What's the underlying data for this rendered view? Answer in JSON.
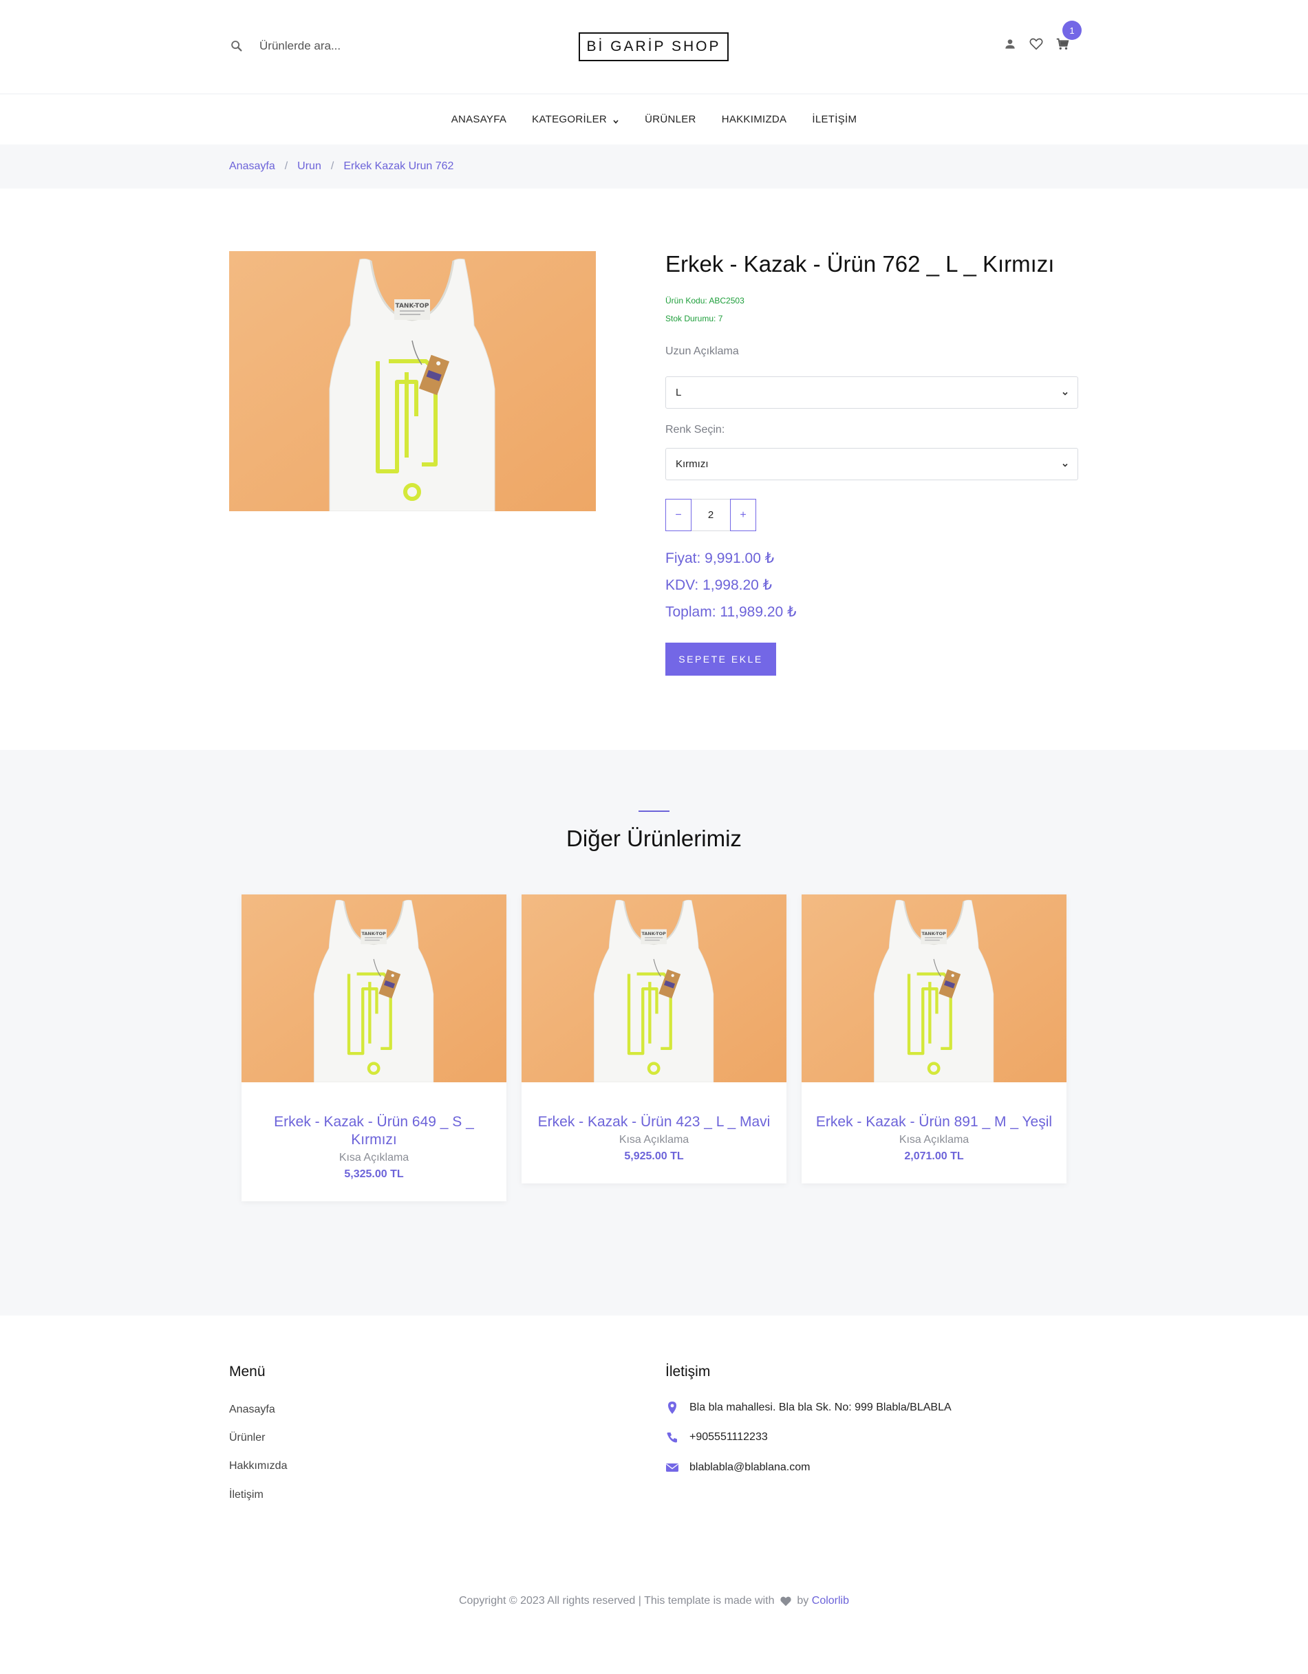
{
  "header": {
    "search_placeholder": "Ürünlerde ara...",
    "logo": "Bİ GARİP SHOP",
    "cart_count": "1",
    "icons": [
      "user-icon",
      "heart-icon",
      "cart-icon"
    ]
  },
  "nav": {
    "items": [
      "ANASAYFA",
      "KATEGORİLER",
      "ÜRÜNLER",
      "HAKKIMIZDA",
      "İLETİŞİM"
    ]
  },
  "breadcrumb": {
    "items": [
      "Anasayfa",
      "Urun",
      "Erkek Kazak Urun 762"
    ],
    "separator": "/"
  },
  "product": {
    "title": "Erkek - Kazak - Ürün 762 _ L _ Kırmızı",
    "code": "Ürün Kodu: ABC2503",
    "stock": "Stok Durumu: 7",
    "size_label": "Uzun Açıklama",
    "size_value": "L",
    "color_label": "Renk Seçin:",
    "color_value": "Kırmızı",
    "qty_minus": "−",
    "qty": "2",
    "qty_plus": "+",
    "price": "Fiyat: 9,991.00 ₺",
    "tax": "KDV: 1,998.20 ₺",
    "total": "Toplam: 11,989.20 ₺",
    "add_to_cart": "SEPETE EKLE"
  },
  "others": {
    "title": "Diğer Ürünlerimiz",
    "cards": [
      {
        "name": "Erkek - Kazak - Ürün 649 _ S _ Kırmızı",
        "desc": "Kısa Açıklama",
        "price": "5,325.00 TL"
      },
      {
        "name": "Erkek - Kazak - Ürün 423 _ L _ Mavi",
        "desc": "Kısa Açıklama",
        "price": "5,925.00 TL"
      },
      {
        "name": "Erkek - Kazak - Ürün 891 _ M _ Yeşil",
        "desc": "Kısa Açıklama",
        "price": "2,071.00 TL"
      }
    ]
  },
  "footer": {
    "menu_title": "Menü",
    "menu": [
      "Anasayfa",
      "Ürünler",
      "Hakkımızda",
      "İletişim"
    ],
    "contact_title": "İletişim",
    "address": "Bla bla mahallesi. Bla bla Sk. No: 999 Blabla/BLABLA",
    "phone": "+905551112233",
    "email": "blablabla@blablana.com",
    "copyright_pre": "Copyright © 2023 All rights reserved | This template is made with",
    "copyright_by": "by",
    "copyright_link": "Colorlib"
  },
  "colors": {
    "accent": "#7367e6",
    "stock_green": "#1d9e3a",
    "image_bg": "#f2b173"
  }
}
